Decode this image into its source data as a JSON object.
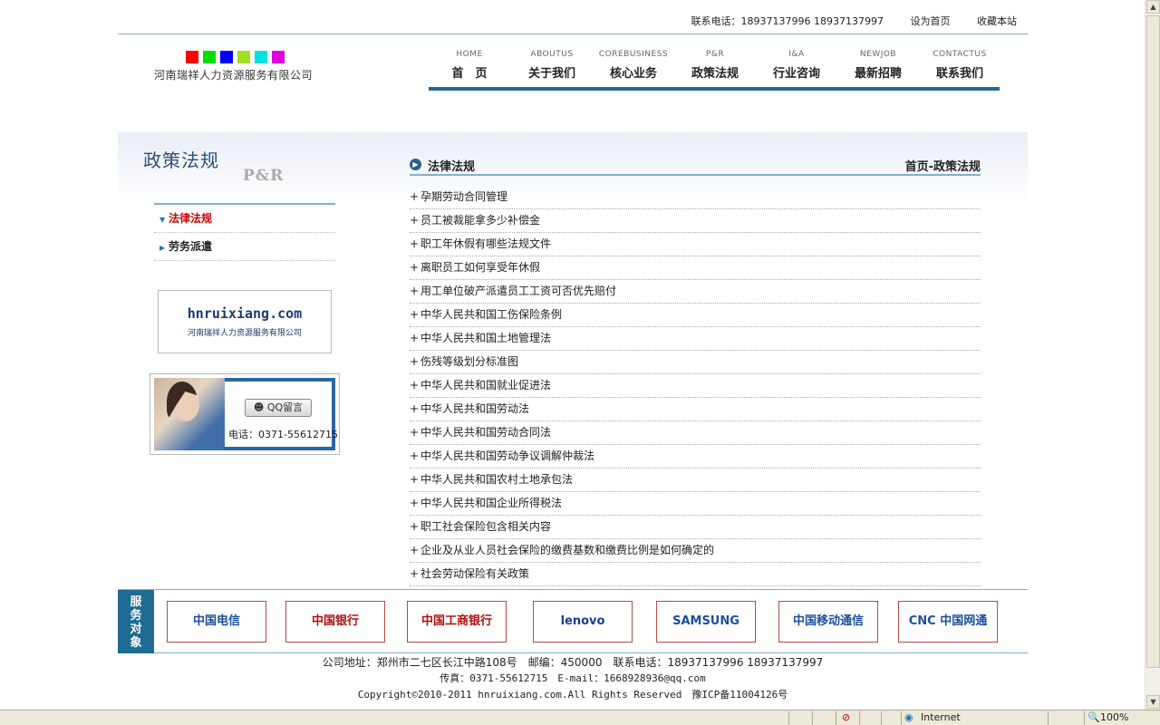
{
  "topbar": {
    "tel": "联系电话：18937137996 18937137997",
    "set_home": "设为首页",
    "bookmark": "收藏本站"
  },
  "logo": {
    "company": "河南瑞祥人力资源服务有限公司",
    "colors": [
      "#ff0000",
      "#00e000",
      "#0000ff",
      "#a0e020",
      "#00e0e0",
      "#e000e0"
    ]
  },
  "nav": [
    {
      "en": "HOME",
      "cn": "首　页"
    },
    {
      "en": "ABOUTUS",
      "cn": "关于我们"
    },
    {
      "en": "COREBUSINESS",
      "cn": "核心业务"
    },
    {
      "en": "P&R",
      "cn": "政策法规"
    },
    {
      "en": "I&A",
      "cn": "行业咨询"
    },
    {
      "en": "NEWJOB",
      "cn": "最新招聘"
    },
    {
      "en": "CONTACTUS",
      "cn": "联系我们"
    }
  ],
  "sidebar": {
    "title": "政策法规",
    "title_en": "P&R",
    "menu": [
      "法律法规",
      "劳务派遣"
    ],
    "ad_domain": "hnruixiang.com",
    "ad_company": "河南瑞祥人力资源服务有限公司",
    "qq_button": "QQ留言",
    "qq_tel": "电话：0371-55612715"
  },
  "content": {
    "title": "法律法规",
    "breadcrumb": "首页-政策法规",
    "items": [
      "孕期劳动合同管理",
      "员工被裁能拿多少补偿金",
      "职工年休假有哪些法规文件",
      "离职员工如何享受年休假",
      "用工单位破产派遣员工工资可否优先赔付",
      "中华人民共和国工伤保险条例",
      "中华人民共和国土地管理法",
      "伤残等级划分标准图",
      "中华人民共和国就业促进法",
      "中华人民共和国劳动法",
      "中华人民共和国劳动合同法",
      "中华人民共和国劳动争议调解仲裁法",
      "中华人民共和国农村土地承包法",
      "中华人民共和国企业所得税法",
      "职工社会保险包含相关内容",
      "企业及从业人员社会保险的缴费基数和缴费比例是如何确定的",
      "社会劳动保险有关政策"
    ]
  },
  "partners": {
    "label": "服务对象",
    "logos": [
      {
        "text": "中国电信",
        "color": "#1b4fa0"
      },
      {
        "text": "中国银行",
        "color": "#b01010"
      },
      {
        "text": "中国工商银行",
        "color": "#b01010"
      },
      {
        "text": "lenovo",
        "color": "#1b3b9a"
      },
      {
        "text": "SAMSUNG",
        "color": "#1b4fa0"
      },
      {
        "text": "中国移动通信",
        "color": "#1b4fa0"
      },
      {
        "text": "CNC 中国网通",
        "color": "#1b4fa0"
      }
    ]
  },
  "footer": {
    "line1": "公司地址：郑州市二七区长江中路108号　邮编：450000　联系电话：18937137996 18937137997",
    "line2": "传真：0371-55612715　E-mail：1668928936@qq.com",
    "line3": "Copyright©2010-2011 hnruixiang.com.All Rights Reserved　豫ICP备11004126号"
  },
  "statusbar": {
    "zone": "Internet",
    "zoom": "100%"
  }
}
